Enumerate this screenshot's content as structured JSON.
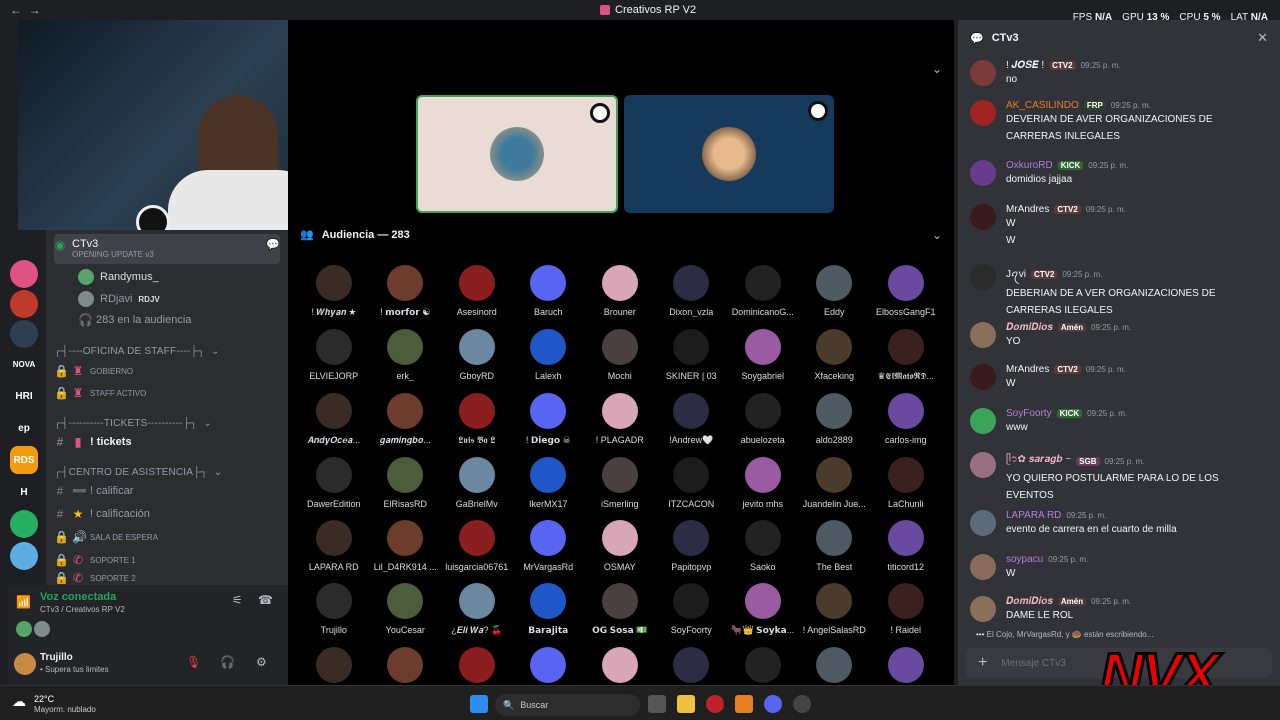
{
  "window": {
    "title": "Creativos RP V2"
  },
  "stats": {
    "fps_label": "FPS",
    "fps": "N/A",
    "gpu_label": "GPU",
    "gpu": "13 %",
    "cpu_label": "CPU",
    "cpu": "5 %",
    "lat_label": "LAT",
    "lat": "N/A"
  },
  "servers": [
    "NOVA",
    "HRI",
    "ep",
    "RDS",
    "H"
  ],
  "channels": {
    "voice_channel": "CTv3",
    "voice_subtitle": "OPENING UPDATE v3",
    "members": [
      {
        "name": "Randymus_"
      },
      {
        "name": "RDjavi",
        "tag": "RDJV"
      }
    ],
    "audience_count": "283 en la audiencia",
    "categories": [
      {
        "title": "┌┤----OFICINA DE STAFF----├┐",
        "items": [
          "GOBIERNO",
          "STAFF ACTIVO"
        ]
      },
      {
        "title": "┌┤----------TICKETS----------├┐",
        "items": [
          "! tickets"
        ]
      },
      {
        "title": "┌┤CENTRO DE ASISTENCIA├┐",
        "items": [
          "! calificar",
          "! calificación",
          "SALA DE ESPERA",
          "SOPORTE 1",
          "SOPORTE 2"
        ]
      }
    ]
  },
  "voice": {
    "status": "Voz conectada",
    "location": "CTv3 / Creativos RP V2"
  },
  "user": {
    "name": "Trujillo",
    "status": "• Supera tus limites"
  },
  "stage": {
    "audience_title": "Audiencia — 283",
    "audience": [
      "! 𝑾𝒉𝒚𝒂𝒏 ★",
      "! 𝗺𝗼𝗿𝗳𝗼𝗿 ☯",
      "Asesinord",
      "Baruch",
      "Brouner",
      "Dixon_vzla",
      "DominicanoG...",
      "Eddy",
      "ElbossGangF1",
      "ELVIEJORP",
      "erk_",
      "GboyRD",
      "Lalexh",
      "Mochi",
      "SKINER | 03",
      "Soygabriel",
      "Xfaceking",
      "♛𝕰𝖑𝕸𝖆𝖙𝖔𝕽𝕯...",
      "𝑨𝒏𝒅𝒚𝑶𝒄𝒆𝒂...",
      "𝒈𝒂𝒎𝒊𝒏𝒈𝒃𝒐...",
      "𝕷𝖚𝖎𝖘 𝕭𝖆 𝕷",
      "! 𝗗𝗶𝗲𝗴𝗼 ☠",
      "! PLAGADR",
      "!Andrew🤍",
      "abuelozeta",
      "aldo2889",
      "carlos-img",
      "DawerEdition",
      "ElRisasRD",
      "GaBrielMv",
      "IkerMX17",
      "iSmerling",
      "ITZCACON",
      "jevito mhs",
      "Juandelin Jue...",
      "LaChunli",
      "LAPARA RD",
      "Lil_D4RK914 ...",
      "luisgarcia06761",
      "MrVargasRd",
      "OSMAY",
      "Papitopvp",
      "Saoko",
      "The Best",
      "titicord12",
      "Trujillo",
      "YouCesar",
      "¿𝑬𝒍𝒊 𝑾𝒂? 🍒",
      "𝗕𝗮𝗿𝗮𝗷𝗶𝘁𝗮",
      "𝗢𝗚 𝗦𝗼𝘀𝗮 💵",
      "SoyFoorty",
      "🐂👑 𝗦𝗼𝘆𝗸𝗮...",
      "! AngelSalasRD",
      "! Raidel",
      "",
      "",
      "",
      "",
      "",
      "",
      "",
      "",
      ""
    ]
  },
  "chat": {
    "title": "CTv3",
    "messages": [
      {
        "author": "! 𝑱𝑶𝑺𝑬 !",
        "tag": "CTV2",
        "time": "09:25 p. m.",
        "text": [
          "no"
        ],
        "color": "#f2f3f5"
      },
      {
        "author": "AK_CASILINDO",
        "tag": "FRP",
        "time": "09:25 p. m.",
        "text": [
          "DEVERIAN DE AVER ORGANIZACIONES DE",
          "CARRERAS INLEGALES"
        ],
        "color": "#e67e22"
      },
      {
        "author": "OxkuroRD",
        "tag": "KICK",
        "time": "09:25 p. m.",
        "text": [
          "domidios jajjaa"
        ],
        "color": "#b57edc"
      },
      {
        "author": "MrAndres",
        "tag": "CTV2",
        "time": "09:25 p. m.",
        "text": [
          "W",
          "W"
        ],
        "color": "#f2f3f5"
      },
      {
        "author": "Jꪖvi",
        "tag": "CTV2",
        "time": "09:25 p. m.",
        "text": [
          "DEBERIAN DE A VER ORGANIZACIONES DE",
          "CARRERAS ILEGALES"
        ],
        "color": "#f2f3f5"
      },
      {
        "author": "𝑫𝒐𝒎𝒊𝑫𝒊𝒐𝒔",
        "tag": "Amén",
        "time": "09:25 p. m.",
        "text": [
          "YO"
        ],
        "color": "#f0b3c8"
      },
      {
        "author": "MrAndres",
        "tag": "CTV2",
        "time": "09:25 p. m.",
        "text": [
          "W"
        ],
        "color": "#f2f3f5"
      },
      {
        "author": "SoyFoorty",
        "tag": "KICK",
        "time": "09:25 p. m.",
        "text": [
          "www"
        ],
        "color": "#b57edc"
      },
      {
        "author": "ᥫ᭡✿ 𝒔𝒂𝒓𝒂𝒈𝒃 ~",
        "tag": "SGB",
        "time": "09:25 p. m.",
        "text": [
          "YO QUIERO POSTULARME PARA LO DE LOS",
          "EVENTOS"
        ],
        "color": "#f0b3c8"
      },
      {
        "author": "LAPARA RD",
        "tag": "",
        "time": "09:25 p. m.",
        "text": [
          "evento de carrera en el cuarto de milla"
        ],
        "color": "#b57edc"
      },
      {
        "author": "soypacu",
        "tag": "",
        "time": "09:25 p. m.",
        "text": [
          "W"
        ],
        "color": "#b57edc"
      },
      {
        "author": "𝑫𝒐𝒎𝒊𝑫𝒊𝒐𝒔",
        "tag": "Amén",
        "time": "09:25 p. m.",
        "text": [
          "DAME LE ROL"
        ],
        "color": "#f0b3c8"
      }
    ],
    "typing": "El Cojo, MrVargasRd, y 🍩 están escribiendo...",
    "input_placeholder": "Mensaje CTv3"
  },
  "taskbar": {
    "temp": "22°C",
    "weather": "Mayorm. nublado",
    "search": "Buscar"
  },
  "watermark": "NVX"
}
